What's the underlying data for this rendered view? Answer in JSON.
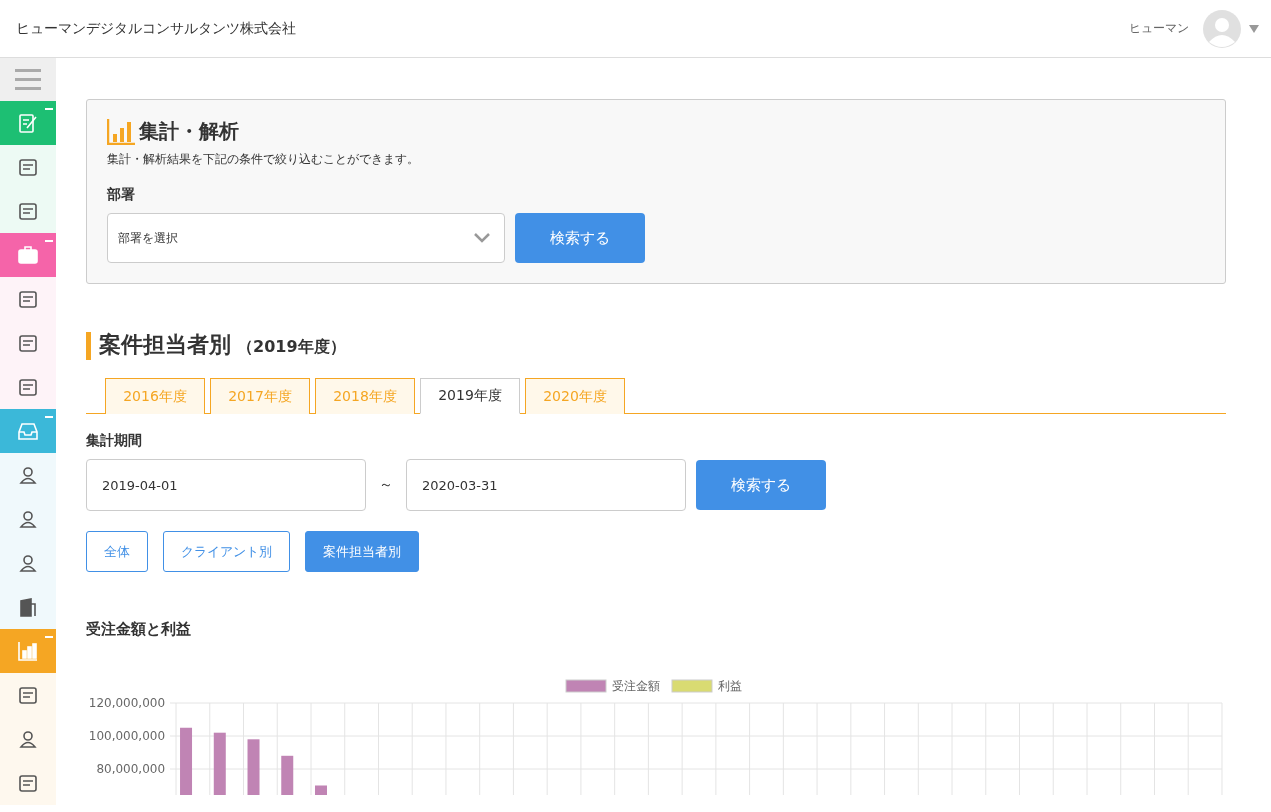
{
  "header": {
    "company": "ヒューマンデジタルコンサルタンツ株式会社",
    "user_name": "ヒューマン"
  },
  "sidebar": {
    "groups": [
      {
        "color": "#1dbf73",
        "expanded": true
      },
      {
        "color": "#f564a9",
        "expanded": true
      },
      {
        "color": "#3bb8d9",
        "expanded": true
      },
      {
        "color": "#f5a623",
        "expanded": true
      }
    ]
  },
  "filter_card": {
    "title": "集計・解析",
    "description": "集計・解析結果を下記の条件で絞り込むことができます。",
    "department_label": "部署",
    "department_select": {
      "value": "部署を選択"
    },
    "search_button": "検索する"
  },
  "section": {
    "title": "案件担当者別",
    "subtitle": "（2019年度）"
  },
  "tabs": [
    {
      "label": "2016年度",
      "selected": false
    },
    {
      "label": "2017年度",
      "selected": false
    },
    {
      "label": "2018年度",
      "selected": false
    },
    {
      "label": "2019年度",
      "selected": true
    },
    {
      "label": "2020年度",
      "selected": false
    }
  ],
  "period": {
    "label": "集計期間",
    "start": "2019-04-01",
    "separator": "～",
    "end": "2020-03-31",
    "search_button": "検索する"
  },
  "view_buttons": [
    {
      "label": "全体",
      "selected": false
    },
    {
      "label": "クライアント別",
      "selected": false
    },
    {
      "label": "案件担当者別",
      "selected": true
    }
  ],
  "chart_section": {
    "title": "受注金額と利益",
    "chart_data": {
      "type": "bar",
      "ylim": [
        64000000,
        120000000
      ],
      "yticks": [
        {
          "value": 80000000,
          "label": "80,000,000"
        },
        {
          "value": 100000000,
          "label": "100,000,000"
        },
        {
          "value": 120000000,
          "label": "120,000,000"
        }
      ],
      "series": [
        {
          "name": "受注金額",
          "color": "#c084b4",
          "values": [
            105000000,
            102000000,
            98000000,
            88000000,
            70000000,
            null,
            null,
            null,
            null,
            null,
            null,
            null,
            null,
            null,
            null,
            null,
            null,
            null,
            null,
            null,
            null,
            null,
            null,
            null,
            null,
            null,
            null,
            null,
            null,
            null,
            null
          ]
        },
        {
          "name": "利益",
          "color": "#d9db72",
          "values": [
            null,
            null,
            null,
            null,
            null,
            null,
            null,
            null,
            null,
            null,
            null,
            null,
            null,
            null,
            null,
            null,
            null,
            null,
            null,
            null,
            null,
            null,
            null,
            null,
            null,
            null,
            null,
            null,
            null,
            null,
            null
          ]
        }
      ]
    }
  }
}
